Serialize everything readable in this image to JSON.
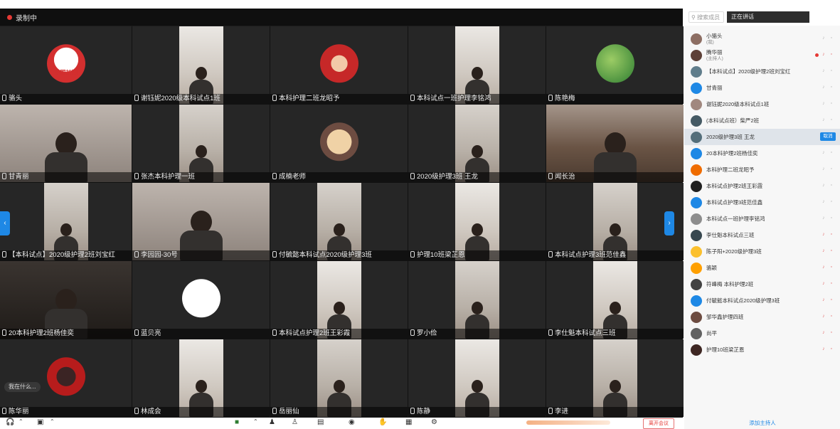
{
  "recording_label": "录制中",
  "speaking_chip": "我在什么...",
  "tiles": [
    {
      "name": "骆头",
      "style": "flag",
      "avatar_text": "中国加油"
    },
    {
      "name": "谢钰妮2020级本科试点1班",
      "style": "cam"
    },
    {
      "name": "本科护理二班龙昭予",
      "style": "red"
    },
    {
      "name": "本科试点一班护理李铭鸿",
      "style": "cam"
    },
    {
      "name": "陈艳梅",
      "style": "green"
    },
    {
      "name": "甘青丽",
      "style": "bigcam"
    },
    {
      "name": "张杰本科护理一班",
      "style": "cam"
    },
    {
      "name": "成楠老师",
      "style": "dog"
    },
    {
      "name": "2020级护理3班 王龙",
      "style": "cam"
    },
    {
      "name": "闻长治",
      "style": "room"
    },
    {
      "name": "【本科试点】2020级护理2班刘宝红",
      "style": "cam"
    },
    {
      "name": "李园园-30号",
      "style": "bigcam"
    },
    {
      "name": "付毓懿本科试点2020级护理3班",
      "style": "cam"
    },
    {
      "name": "护理10班梁芷恩",
      "style": "cam"
    },
    {
      "name": "本科试点护理3班范佳鑫",
      "style": "cam"
    },
    {
      "name": "20本科护理2班杨佳奕",
      "style": "dark"
    },
    {
      "name": "蓝贝亮",
      "style": "blank"
    },
    {
      "name": "本科试点护理2班王彩霞",
      "style": "cam"
    },
    {
      "name": "罗小俭",
      "style": "cam"
    },
    {
      "name": "李仕魁本科试点三班",
      "style": "cam"
    },
    {
      "name": "陈华丽",
      "style": "anime"
    },
    {
      "name": "林成会",
      "style": "cam"
    },
    {
      "name": "岳丽仙",
      "style": "cam"
    },
    {
      "name": "陈静",
      "style": "cam"
    },
    {
      "name": "李进",
      "style": "cam"
    }
  ],
  "toolbar": {
    "end_label": "离开会议"
  },
  "panel": {
    "search_placeholder": "搜索成员",
    "speaking_label": "正在讲话",
    "invite_label": "添加主持人",
    "unmute_label": "取消",
    "members": [
      {
        "name": "小骆头",
        "sub": "(我)",
        "color": "#8d6e63"
      },
      {
        "name": "腾华丽",
        "sub": "(主持人)",
        "color": "#5d4037",
        "recording": true
      },
      {
        "name": "【本科试点】2020级护理2班刘宝红",
        "color": "#607d8b"
      },
      {
        "name": "甘青丽",
        "color": "#1e88e5"
      },
      {
        "name": "谢钰妮2020级本科试点1班",
        "color": "#a1887f"
      },
      {
        "name": "(本科试点班）柴严2班",
        "color": "#455a64"
      },
      {
        "name": "2020级护理3班 王龙",
        "color": "#546e7a",
        "selected": true
      },
      {
        "name": "20本科护理2班杨佳奕",
        "color": "#1e88e5"
      },
      {
        "name": "本科护理二班龙昭予",
        "color": "#ef6c00"
      },
      {
        "name": "本科试点护理2班王彩霞",
        "color": "#212121"
      },
      {
        "name": "本科试点护理3班范佳鑫",
        "color": "#1e88e5"
      },
      {
        "name": "本科试点一班护理李铭鸿",
        "color": "#8d8d8d"
      },
      {
        "name": "李仕魁本科试点三班",
        "color": "#37474f"
      },
      {
        "name": "陈子阳+2020级护理3班",
        "color": "#fbc02d"
      },
      {
        "name": "骆颖",
        "color": "#ffa000"
      },
      {
        "name": "符峰梅 本科护理2班",
        "color": "#424242"
      },
      {
        "name": "付毓懿本科试点2020级护理3班",
        "color": "#1e88e5"
      },
      {
        "name": "邹华鑫护理四班",
        "color": "#6d4c41"
      },
      {
        "name": "尚平",
        "color": "#616161"
      },
      {
        "name": "护理10班梁芷恩",
        "color": "#3e2723"
      }
    ]
  }
}
